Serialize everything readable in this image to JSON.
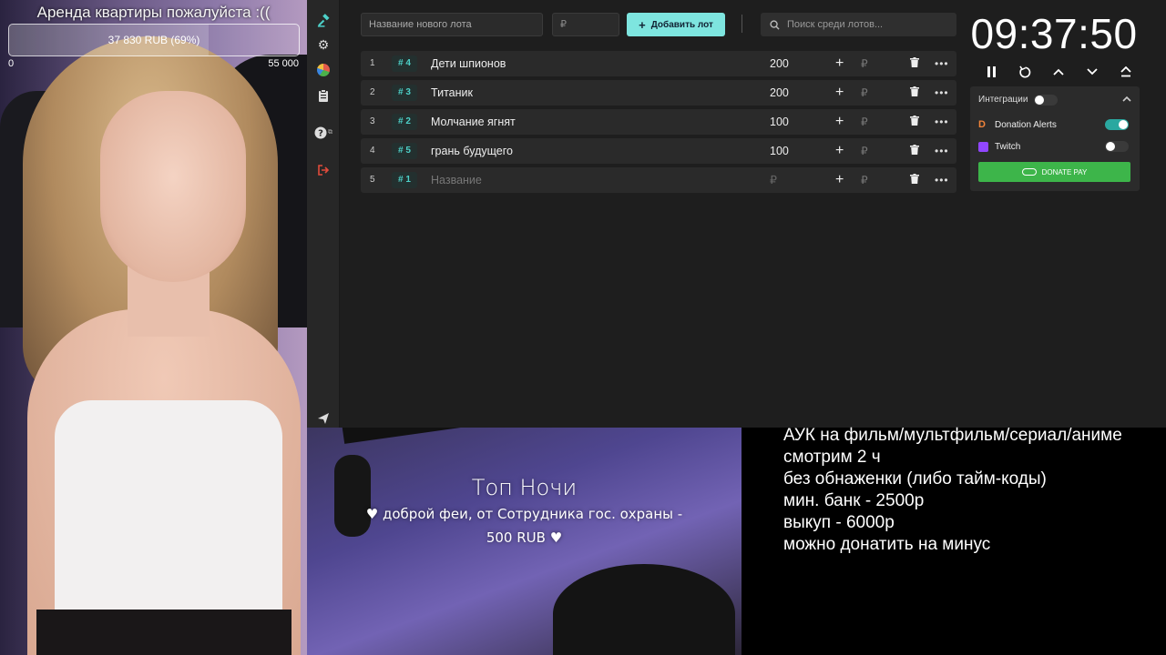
{
  "donation_goal": {
    "title": "Аренда квартиры пожалуйста :((",
    "progress_text": "37 830 RUB (69%)",
    "progress_fraction": 0.69,
    "min": "0",
    "max": "55 000"
  },
  "nav": {
    "items": [
      "auction-icon",
      "gear-icon",
      "pie-chart-icon",
      "clipboard-icon",
      "help-icon",
      "exit-icon",
      "send-icon"
    ],
    "help_sup": "⧉"
  },
  "topbar": {
    "lot_placeholder": "Название нового лота",
    "price_placeholder": "₽",
    "add_button": "Добавить лот",
    "search_placeholder": "Поиск среди лотов..."
  },
  "lots": [
    {
      "index": "1",
      "tag": "# 4",
      "name": "Дети шпионов",
      "amount": "200"
    },
    {
      "index": "2",
      "tag": "# 3",
      "name": "Титаник",
      "amount": "200"
    },
    {
      "index": "3",
      "tag": "# 2",
      "name": "Молчание ягнят",
      "amount": "100"
    },
    {
      "index": "4",
      "tag": "# 5",
      "name": "грань будущего",
      "amount": "100"
    },
    {
      "index": "5",
      "tag": "# 1",
      "name": "Название",
      "amount": "₽",
      "placeholder": true
    }
  ],
  "lot_row_labels": {
    "plus": "+",
    "rub": "₽",
    "more": "•••"
  },
  "timer": {
    "value": "09:37:50"
  },
  "integrations": {
    "title": "Интеграции",
    "master_on": false,
    "donation_alerts": {
      "label": "Donation Alerts",
      "on": true
    },
    "twitch": {
      "label": "Twitch",
      "on": false
    },
    "donatepay_button": "DONATE PAY"
  },
  "top_night": {
    "title": "Топ Ночи",
    "line1": "♥ доброй феи, от Сотрудника гос. охраны -",
    "line2": "500 RUB ♥"
  },
  "info_lines": [
    "АУК на фильм/мультфильм/сериал/аниме",
    "смотрим 2 ч",
    "без обнаженки (либо тайм-коды)",
    "мин. банк - 2500р",
    "выкуп - 6000р",
    "можно донатить на минус"
  ],
  "colors": {
    "accent": "#7ee5df",
    "teal_tag": "#4dd0c8",
    "donatepay": "#3db54a",
    "twitch": "#9146ff",
    "danger": "#e24b3b"
  }
}
